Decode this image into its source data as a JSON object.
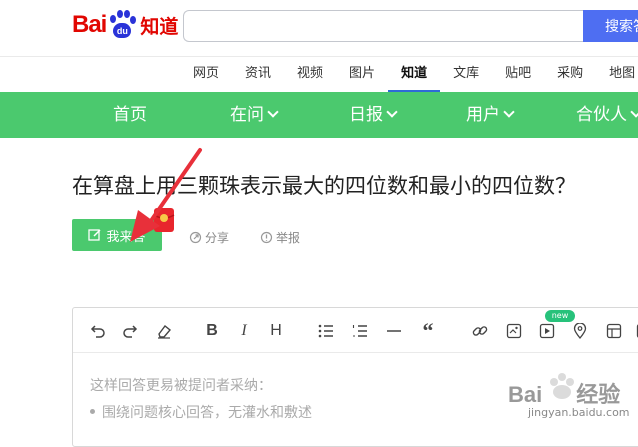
{
  "logo": {
    "bai": "Bai",
    "du": "du",
    "zhidao": "知道"
  },
  "search": {
    "value": "",
    "button_label": "搜索答案"
  },
  "channels": [
    "网页",
    "资讯",
    "视频",
    "图片",
    "知道",
    "文库",
    "贴吧",
    "采购",
    "地图"
  ],
  "active_channel": "知道",
  "nav": {
    "home": "首页",
    "ask": "在问",
    "daily": "日报",
    "user": "用户",
    "partner": "合伙人"
  },
  "question": {
    "title": "在算盘上用三颗珠表示最大的四位数和最小的四位数？",
    "answer_label": "我来答",
    "share_label": "分享",
    "report_label": "举报"
  },
  "editor": {
    "new_badge": "new",
    "hint_title": "这样回答更易被提问者采纳：",
    "hints": [
      "围绕问题核心回答，无灌水和敷述"
    ]
  },
  "watermark": {
    "text": "Bai",
    "text2": "经验",
    "url": "jingyan.baidu.com"
  },
  "colors": {
    "brand_red": "#e10601",
    "brand_blue": "#2a33d8",
    "nav_green": "#4bc96e",
    "search_blue": "#4e6ef2",
    "arrow_red": "#e8303a"
  }
}
